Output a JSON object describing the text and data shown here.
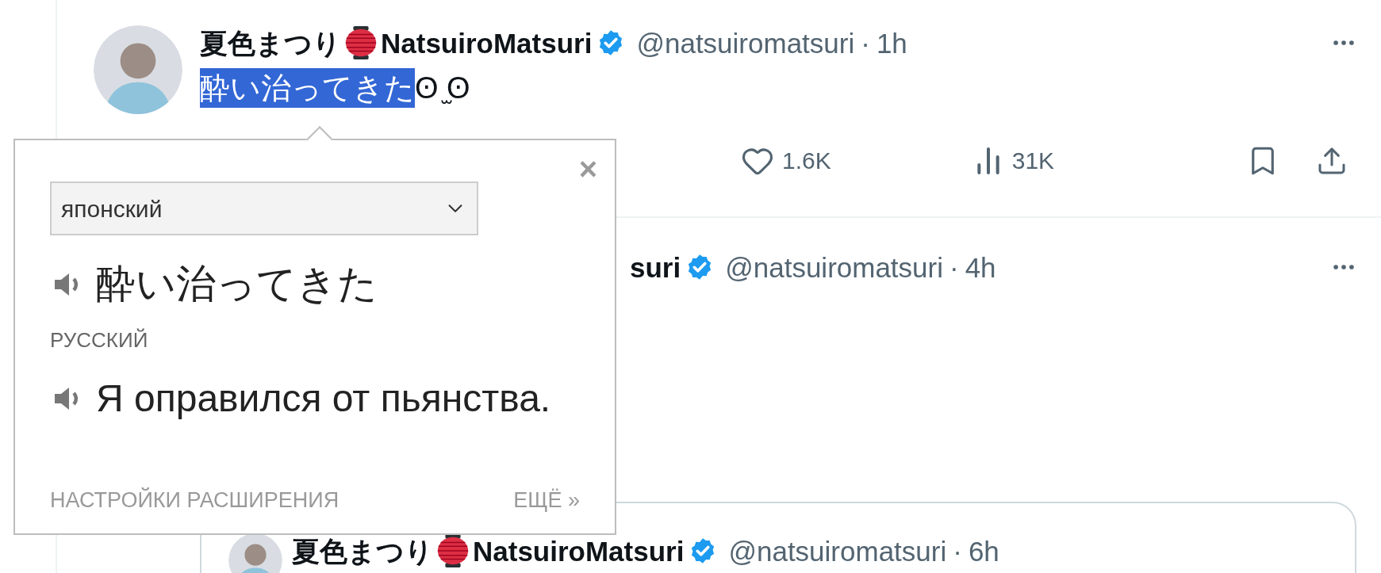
{
  "tweets": [
    {
      "name_jp": "夏色まつり",
      "name_en": "NatsuiroMatsuri",
      "handle": "@natsuiromatsuri",
      "separator": "·",
      "time": "1h",
      "text": [
        {
          "text": "酔い治ってきた",
          "selected": true
        },
        {
          "text": "ʘ ̫ʘ",
          "selected": false
        }
      ],
      "likes": "1.6K",
      "views": "31K"
    },
    {
      "name_en": "suri",
      "handle": "@natsuiromatsuri",
      "separator": "·",
      "time": "4h",
      "quote": {
        "name_jp": "夏色まつり",
        "name_en": "NatsuiroMatsuri",
        "handle": "@natsuiromatsuri",
        "separator": "·",
        "time": "6h"
      }
    }
  ],
  "translator": {
    "close": "×",
    "source_language": "японский",
    "source_text": "酔い治ってきた",
    "target_language": "РУССКИЙ",
    "translation": "Я оправился от пьянства.",
    "settings_link": "НАСТРОЙКИ РАСШИРЕНИЯ",
    "more_link": "ЕЩЁ »"
  }
}
